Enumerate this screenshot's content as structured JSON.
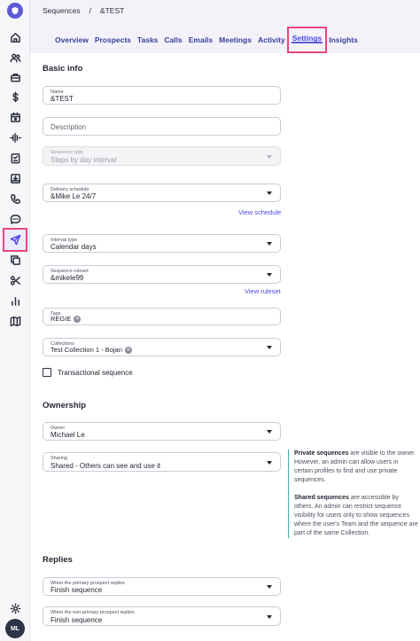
{
  "breadcrumb": {
    "parent": "Sequences",
    "separator": "/",
    "current": "&TEST"
  },
  "tabs": [
    {
      "label": "Overview"
    },
    {
      "label": "Prospects"
    },
    {
      "label": "Tasks"
    },
    {
      "label": "Calls"
    },
    {
      "label": "Emails"
    },
    {
      "label": "Meetings"
    },
    {
      "label": "Activity"
    },
    {
      "label": "Settings",
      "active": true
    },
    {
      "label": "Insights"
    }
  ],
  "sidebar": {
    "icons": [
      "home-icon",
      "people-icon",
      "briefcase-icon",
      "dollar-icon",
      "calendar-icon",
      "pulse-icon",
      "clipboard-icon",
      "inbox-icon",
      "phone-icon",
      "chat-icon",
      "send-icon",
      "copy-icon",
      "scissors-icon",
      "bar-chart-icon",
      "map-icon",
      "settings-icon"
    ],
    "active_icon": "send-icon",
    "avatar_initials": "ML"
  },
  "basic_info": {
    "title": "Basic info",
    "name": {
      "label": "Name",
      "value": "&TEST"
    },
    "description": {
      "placeholder": "Description"
    },
    "sequence_type": {
      "label": "Sequence type",
      "value": "Steps by day interval"
    },
    "delivery_schedule": {
      "label": "Delivery schedule",
      "value": "&Mike Le 24/7",
      "link": "View schedule"
    },
    "interval_type": {
      "label": "Interval type",
      "value": "Calendar days"
    },
    "sequence_ruleset": {
      "label": "Sequence ruleset",
      "value": "&mikele99",
      "link": "View ruleset"
    },
    "tags": {
      "label": "Tags",
      "chips": [
        "REGIE"
      ]
    },
    "collections": {
      "label": "Collections",
      "chips": [
        "Test Collection 1 - Bojan"
      ]
    },
    "transactional": {
      "label": "Transactional sequence",
      "checked": false
    }
  },
  "ownership": {
    "title": "Ownership",
    "owner": {
      "label": "Owner",
      "value": "Michael Le"
    },
    "sharing": {
      "label": "Sharing",
      "value": "Shared - Others can see and use it"
    },
    "info": {
      "private_bold": "Private sequences",
      "private_text": " are visible to the owner. However, an admin can allow users in certain profiles to find and use private sequences.",
      "shared_bold": "Shared sequences",
      "shared_text": " are accessible by others. An admin can restrict sequence visibility for users only to show sequences where the user's Team and the sequence are part of the same Collection."
    }
  },
  "replies": {
    "title": "Replies",
    "primary": {
      "label": "When the primary prospect replies",
      "value": "Finish sequence"
    },
    "non_primary": {
      "label": "When the non-primary prospect replies",
      "value": "Finish sequence"
    }
  },
  "colors": {
    "accent": "#4f46e5",
    "highlight": "#e8467c",
    "info_bar": "#3fb6b0"
  }
}
